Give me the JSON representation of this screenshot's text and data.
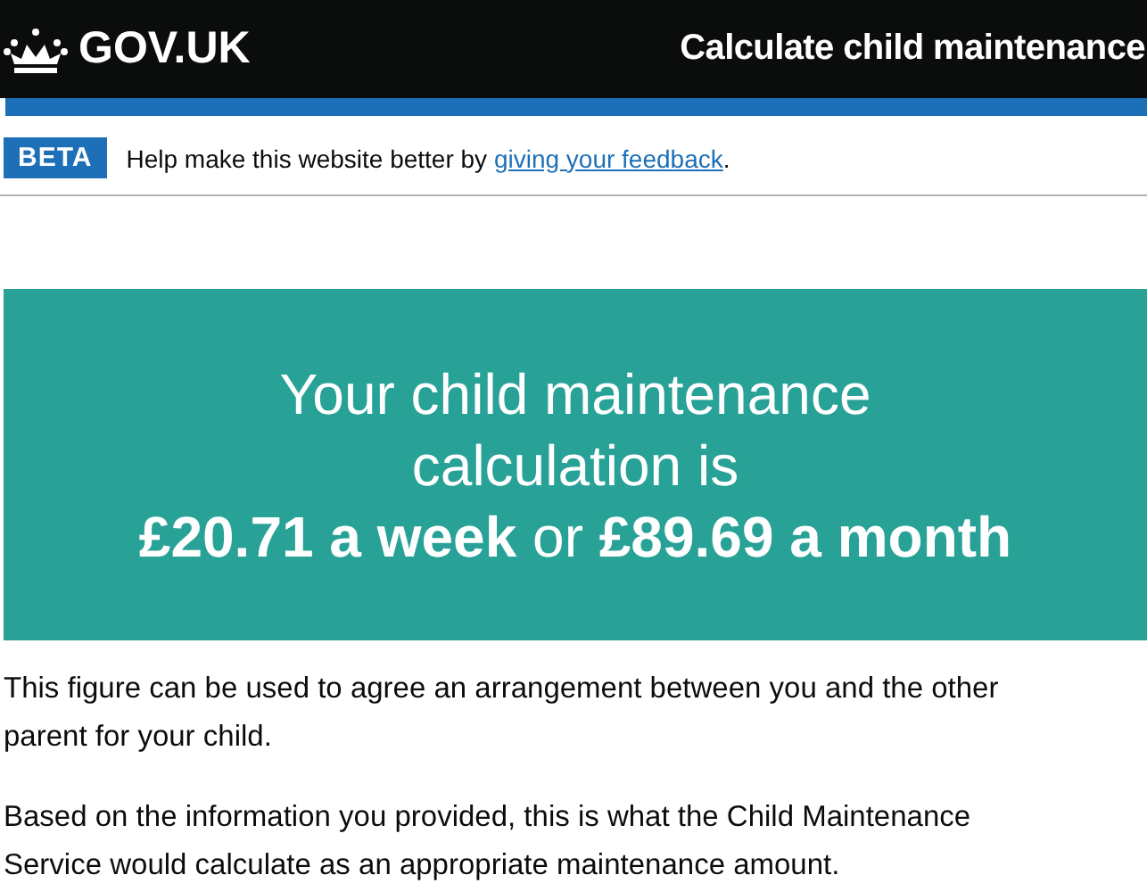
{
  "header": {
    "logo": "GOV.UK",
    "service_name": "Calculate child maintenance"
  },
  "phase_banner": {
    "tag": "BETA",
    "text": "Help make this website better by ",
    "link": "giving your feedback",
    "end": "."
  },
  "panel": {
    "title": "Your child maintenance calculation is",
    "body": "**£20.71 a week** or **£89.69 a month**"
  },
  "paragraphs": [
    "This figure can be used to agree an arrangement between you and the other parent for your child.",
    "Based on the information you provided, this is what the Child Maintenance Service would calculate as an appropriate maintenance amount."
  ]
}
